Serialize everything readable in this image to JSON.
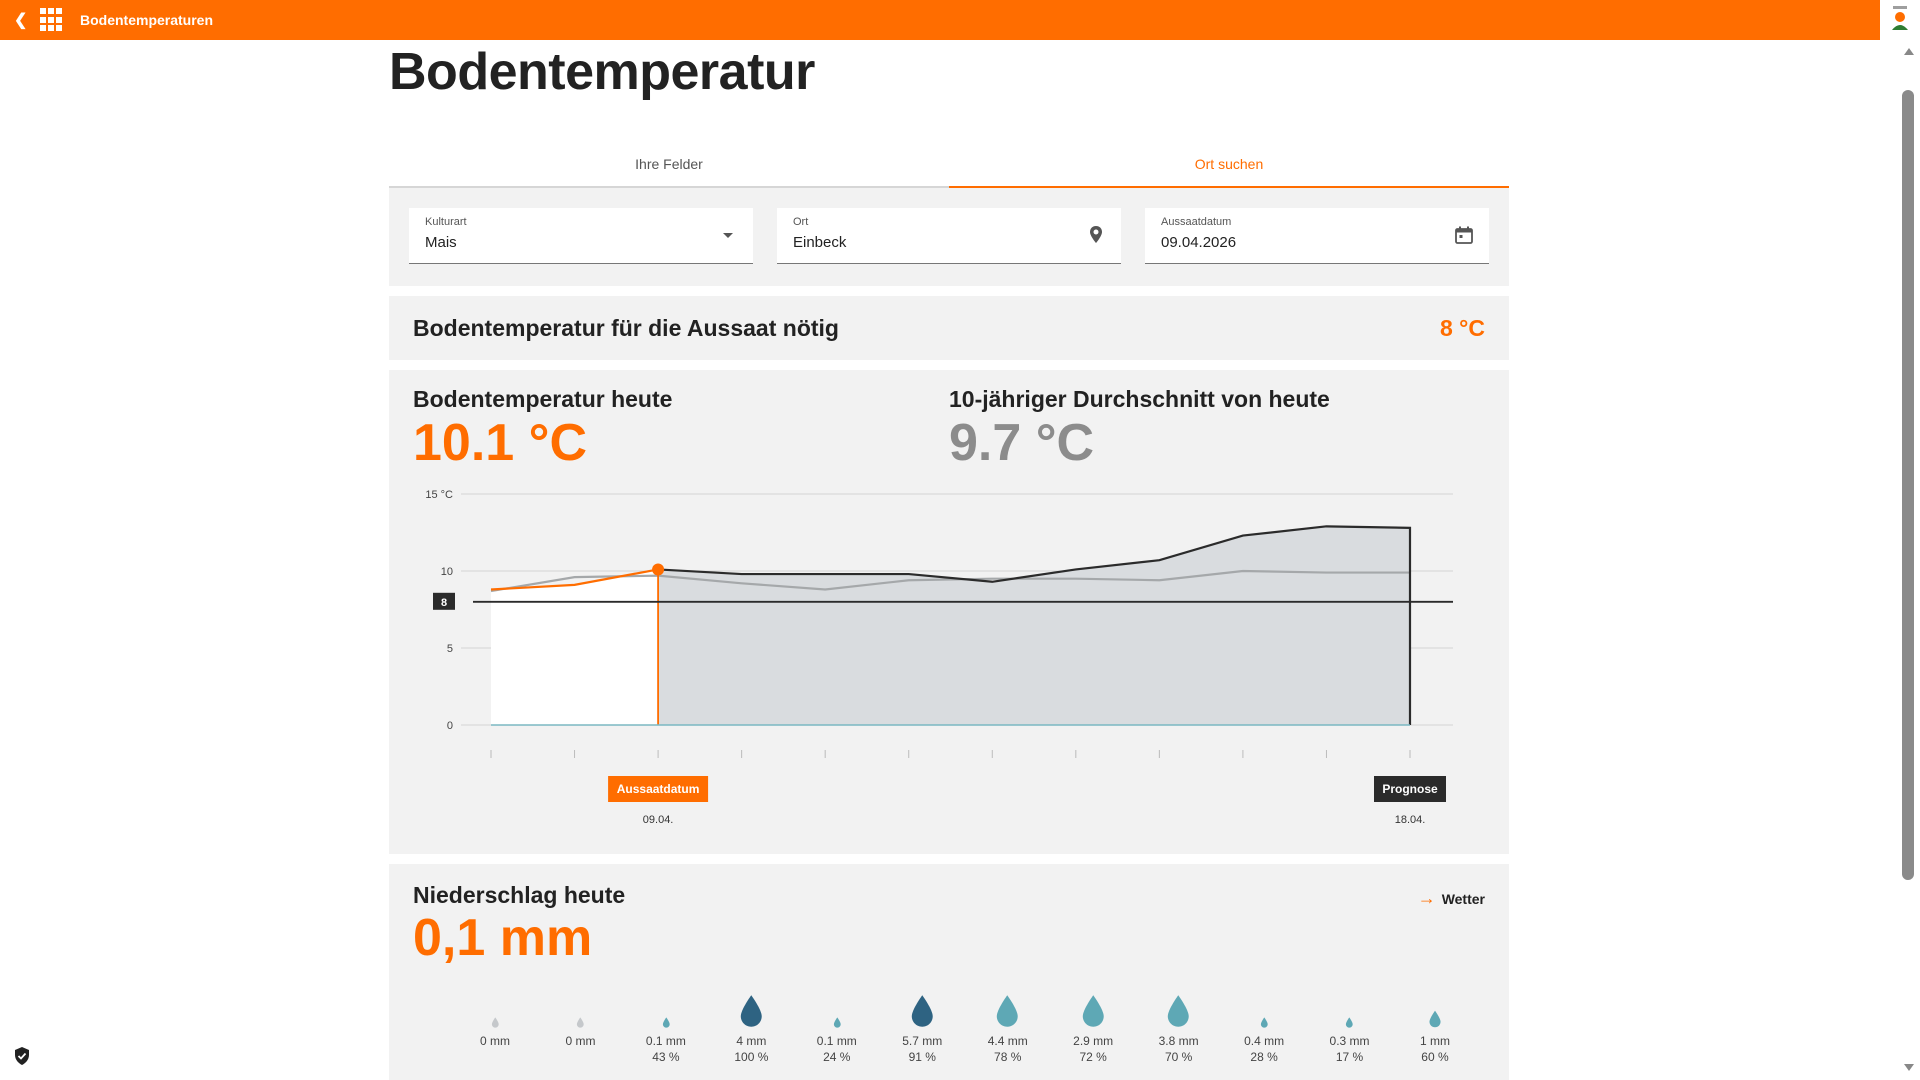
{
  "app": {
    "title": "Bodentemperaturen"
  },
  "page": {
    "title": "Bodentemperatur"
  },
  "tabs": [
    {
      "label": "Ihre Felder",
      "active": false
    },
    {
      "label": "Ort suchen",
      "active": true
    }
  ],
  "filters": {
    "crop": {
      "label": "Kulturart",
      "value": "Mais"
    },
    "location": {
      "label": "Ort",
      "value": "Einbeck"
    },
    "sowing_date": {
      "label": "Aussaatdatum",
      "value": "09.04.2026"
    }
  },
  "required": {
    "label": "Bodentemperatur für die Aussaat nötig",
    "value": "8 °C"
  },
  "today": {
    "label": "Bodentemperatur heute",
    "value": "10.1 °C",
    "avg_label": "10-jähriger Durchschnitt von heute",
    "avg_value": "9.7 °C"
  },
  "colors": {
    "accent": "#ff6d00",
    "dark": "#2b2b2b",
    "gray": "#a5a8aa",
    "area": "#d9dcdf"
  },
  "chart_data": {
    "type": "line",
    "y_ticks": [
      "15 °C",
      "10",
      "5",
      "0"
    ],
    "ylim": [
      0,
      15
    ],
    "threshold": 8,
    "threshold_label": "8",
    "x_count": 12,
    "soil_temp_observed": [
      8.8,
      9.1,
      10.1
    ],
    "soil_temp_forecast_from_index": 2,
    "soil_temp_all": [
      8.8,
      9.1,
      10.1,
      9.8,
      9.8,
      9.8,
      9.3,
      10.1,
      10.7,
      12.3,
      12.9,
      12.8
    ],
    "ten_year_avg": [
      8.7,
      9.6,
      9.7,
      9.2,
      8.8,
      9.4,
      9.5,
      9.5,
      9.4,
      10.0,
      9.9,
      9.9
    ],
    "sowing_marker": {
      "label": "Aussaatdatum",
      "date": "09.04.",
      "index": 2
    },
    "forecast_marker": {
      "label": "Prognose",
      "date": "18.04.",
      "index": 11
    }
  },
  "rain": {
    "label": "Niederschlag heute",
    "value": "0,1 mm",
    "link": "Wetter",
    "days": [
      {
        "mm": "0 mm",
        "pct": "",
        "level": 0
      },
      {
        "mm": "0 mm",
        "pct": "",
        "level": 0
      },
      {
        "mm": "0.1 mm",
        "pct": "43 %",
        "level": 1
      },
      {
        "mm": "4 mm",
        "pct": "100 %",
        "level": 3
      },
      {
        "mm": "0.1 mm",
        "pct": "24 %",
        "level": 1
      },
      {
        "mm": "5.7 mm",
        "pct": "91 %",
        "level": 3
      },
      {
        "mm": "4.4 mm",
        "pct": "78 %",
        "level": 2
      },
      {
        "mm": "2.9 mm",
        "pct": "72 %",
        "level": 2
      },
      {
        "mm": "3.8 mm",
        "pct": "70 %",
        "level": 2
      },
      {
        "mm": "0.4 mm",
        "pct": "28 %",
        "level": 1
      },
      {
        "mm": "0.3 mm",
        "pct": "17 %",
        "level": 1
      },
      {
        "mm": "1 mm",
        "pct": "60 %",
        "level": 1.5
      }
    ]
  }
}
